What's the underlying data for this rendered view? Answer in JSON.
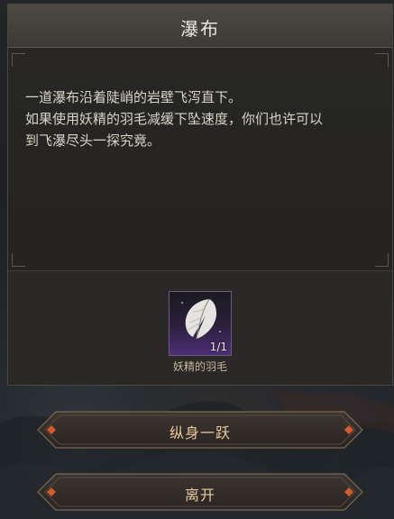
{
  "dialog": {
    "title": "瀑布",
    "description": [
      "一道瀑布沿着陡峭的岩壁飞泻直下。",
      "如果使用妖精的羽毛减缓下坠速度，你们也许可以",
      "到飞瀑尽头一探究竟。"
    ]
  },
  "item": {
    "name": "妖精的羽毛",
    "count": "1/1",
    "icon": "feather-icon",
    "rarity_color": "#4e2f78"
  },
  "choices": [
    {
      "label": "纵身一跃"
    },
    {
      "label": "离开"
    }
  ],
  "colors": {
    "accent": "#e8c8a0",
    "gem": "#d45a2a"
  }
}
